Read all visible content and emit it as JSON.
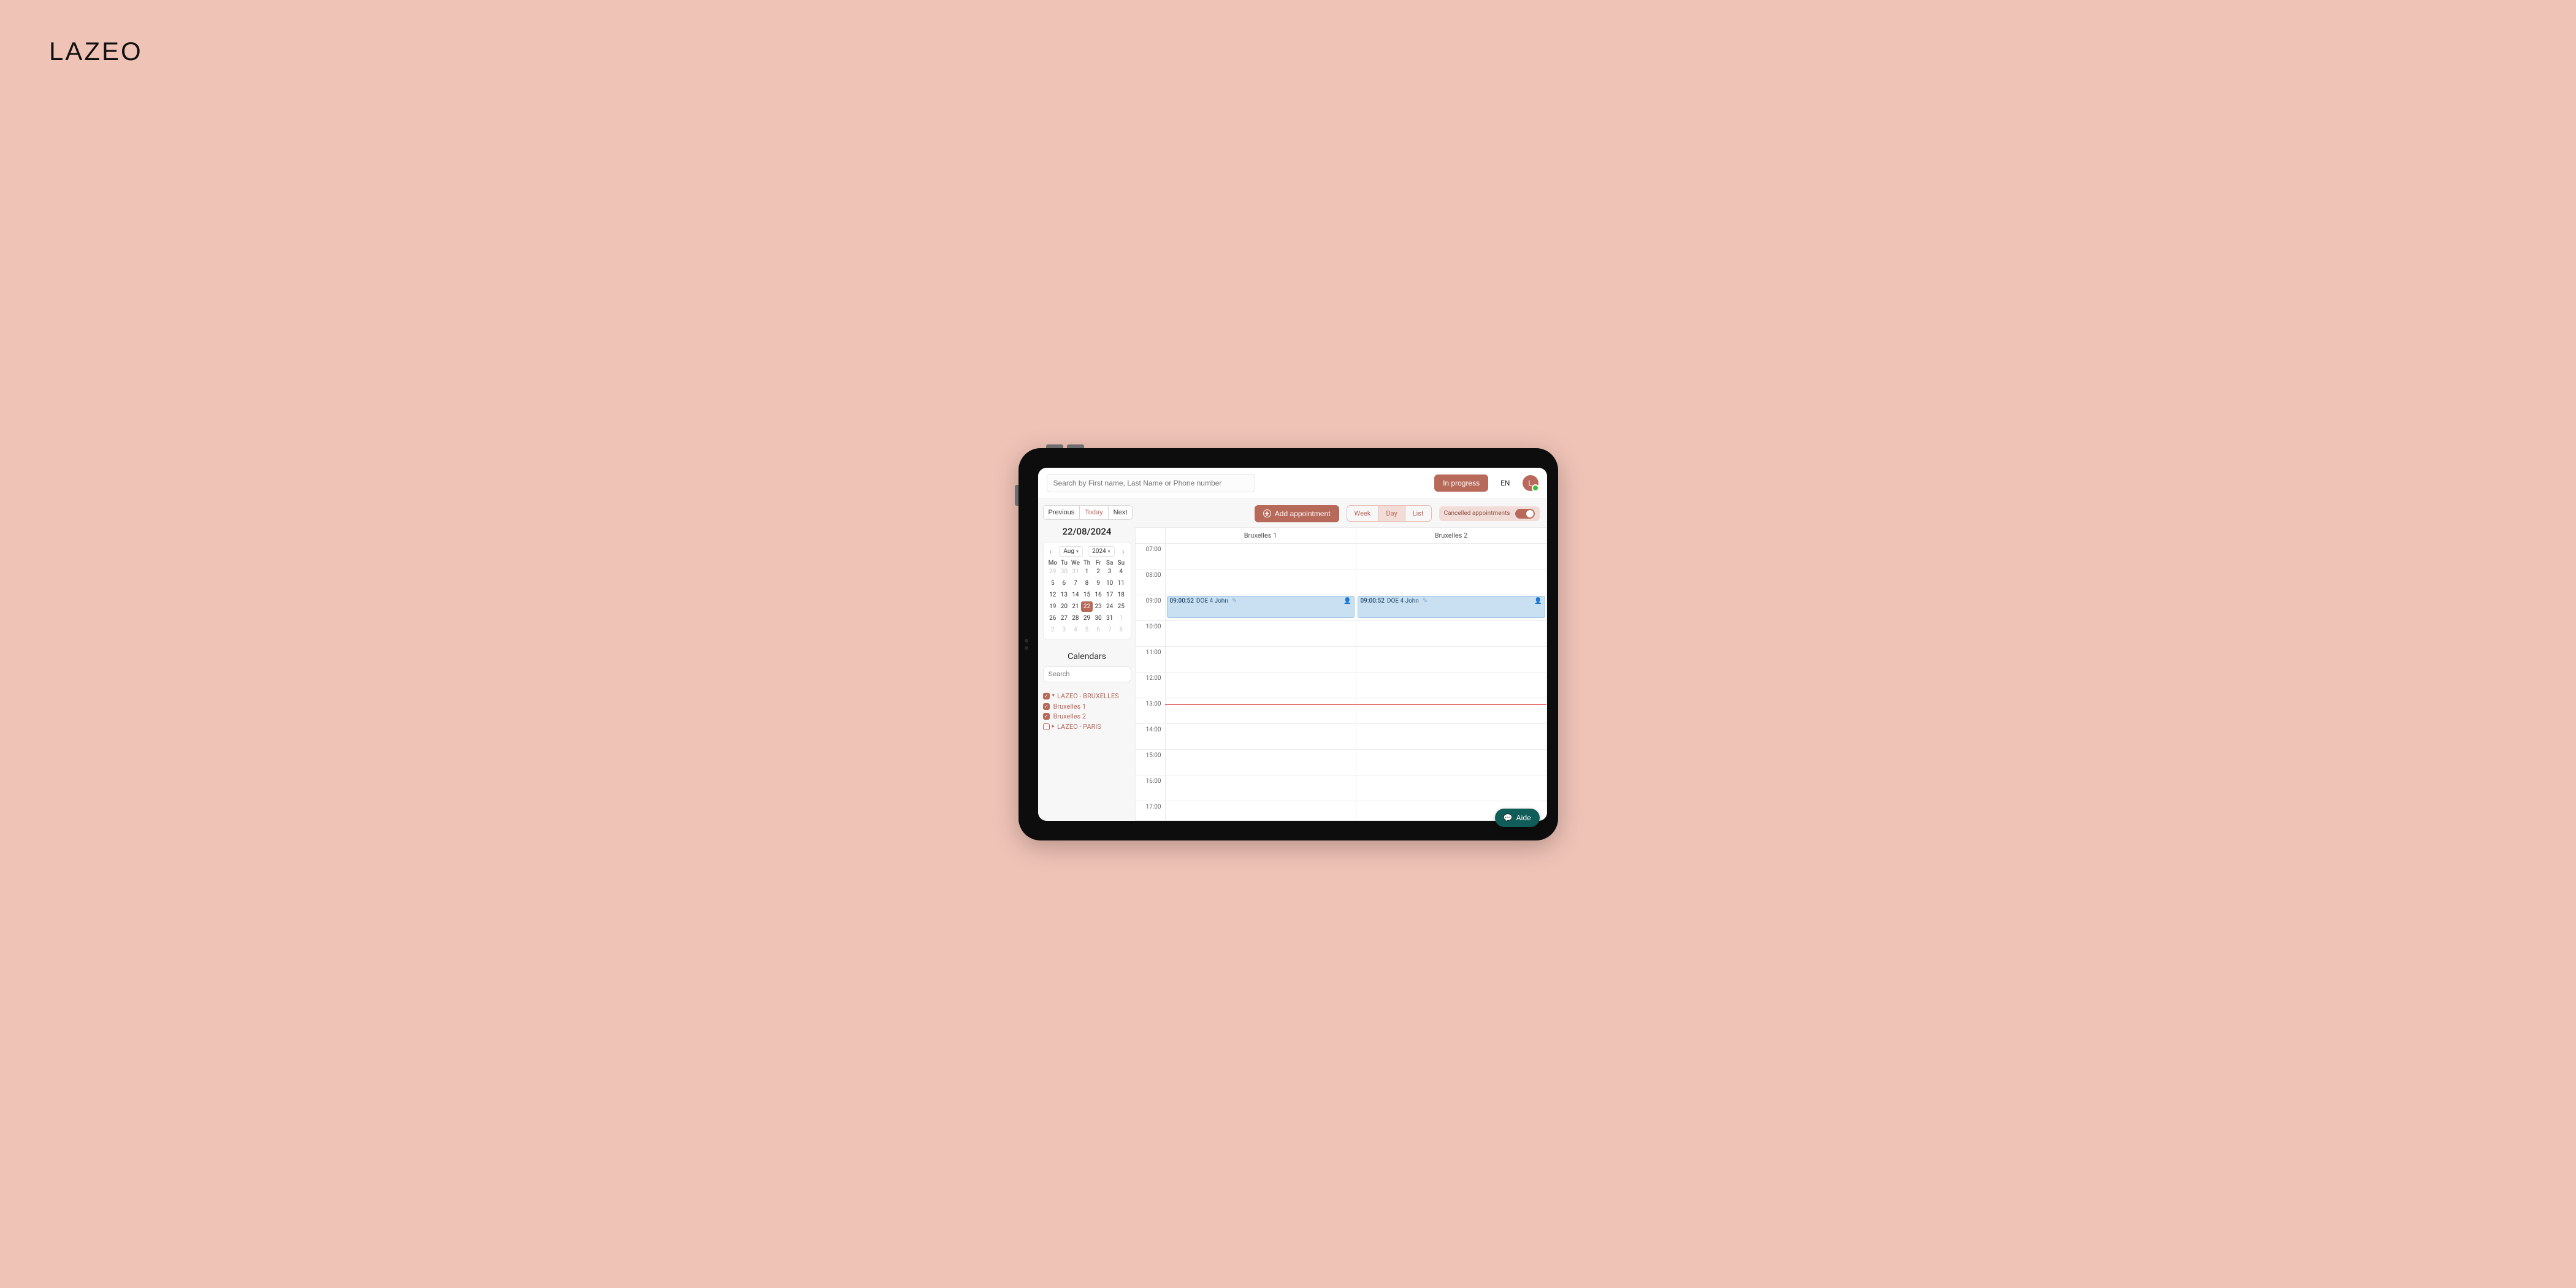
{
  "brand": "LAZEO",
  "topbar": {
    "search_placeholder": "Search by First name, Last Name or Phone number",
    "in_progress": "In progress",
    "lang": "EN",
    "avatar_letter": "L"
  },
  "nav": {
    "previous": "Previous",
    "today": "Today",
    "next": "Next",
    "date_title": "22/08/2024"
  },
  "mini": {
    "month": "Aug",
    "year": "2024",
    "dow": [
      "Mo",
      "Tu",
      "We",
      "Th",
      "Fr",
      "Sa",
      "Su"
    ],
    "days": [
      {
        "n": 29,
        "mute": true
      },
      {
        "n": 30,
        "mute": true
      },
      {
        "n": 31,
        "mute": true
      },
      {
        "n": 1
      },
      {
        "n": 2
      },
      {
        "n": 3
      },
      {
        "n": 4
      },
      {
        "n": 5
      },
      {
        "n": 6
      },
      {
        "n": 7
      },
      {
        "n": 8
      },
      {
        "n": 9
      },
      {
        "n": 10
      },
      {
        "n": 11
      },
      {
        "n": 12
      },
      {
        "n": 13
      },
      {
        "n": 14
      },
      {
        "n": 15
      },
      {
        "n": 16
      },
      {
        "n": 17
      },
      {
        "n": 18
      },
      {
        "n": 19
      },
      {
        "n": 20
      },
      {
        "n": 21
      },
      {
        "n": 22,
        "selected": true
      },
      {
        "n": 23
      },
      {
        "n": 24
      },
      {
        "n": 25
      },
      {
        "n": 26
      },
      {
        "n": 27
      },
      {
        "n": 28
      },
      {
        "n": 29
      },
      {
        "n": 30
      },
      {
        "n": 31
      },
      {
        "n": 1,
        "mute": true
      },
      {
        "n": 2,
        "mute": true
      },
      {
        "n": 3,
        "mute": true
      },
      {
        "n": 4,
        "mute": true
      },
      {
        "n": 5,
        "mute": true
      },
      {
        "n": 6,
        "mute": true
      },
      {
        "n": 7,
        "mute": true
      },
      {
        "n": 8,
        "mute": true
      }
    ]
  },
  "calendars": {
    "title": "Calendars",
    "search_placeholder": "Search",
    "groups": [
      {
        "name": "LAZEO - BRUXELLES",
        "checked": true,
        "expanded": true,
        "children": [
          {
            "name": "Bruxelles 1",
            "checked": true
          },
          {
            "name": "Bruxelles 2",
            "checked": true
          }
        ]
      },
      {
        "name": "LAZEO - PARIS",
        "checked": false,
        "expanded": false,
        "children": []
      }
    ]
  },
  "toolbar": {
    "add_appointment": "Add appointment",
    "views": [
      "Week",
      "Day",
      "List"
    ],
    "active_view": "Day",
    "cancelled_label": "Cancelled appointments",
    "cancelled_on": true
  },
  "calendar": {
    "rooms": [
      "Bruxelles 1",
      "Bruxelles 2"
    ],
    "hours": [
      "07:00",
      "08:00",
      "09:00",
      "10:00",
      "11:00",
      "12:00",
      "13:00",
      "14:00",
      "15:00",
      "16:00",
      "17:00"
    ],
    "now_hour_index": 6,
    "appointments": [
      {
        "room": 0,
        "hour_index": 2,
        "time": "09:00:52",
        "title": "DOE 4 John"
      },
      {
        "room": 1,
        "hour_index": 2,
        "time": "09:00:52",
        "title": "DOE 4 John"
      }
    ]
  },
  "fab": {
    "label": "Aide"
  },
  "colors": {
    "accent": "#b7695a",
    "accent_light": "#f2dcd7",
    "appt_bg": "#c9e0f2",
    "appt_border": "#9ec6e4",
    "now_line": "#e23b3b",
    "fab_bg": "#0f5c59"
  }
}
